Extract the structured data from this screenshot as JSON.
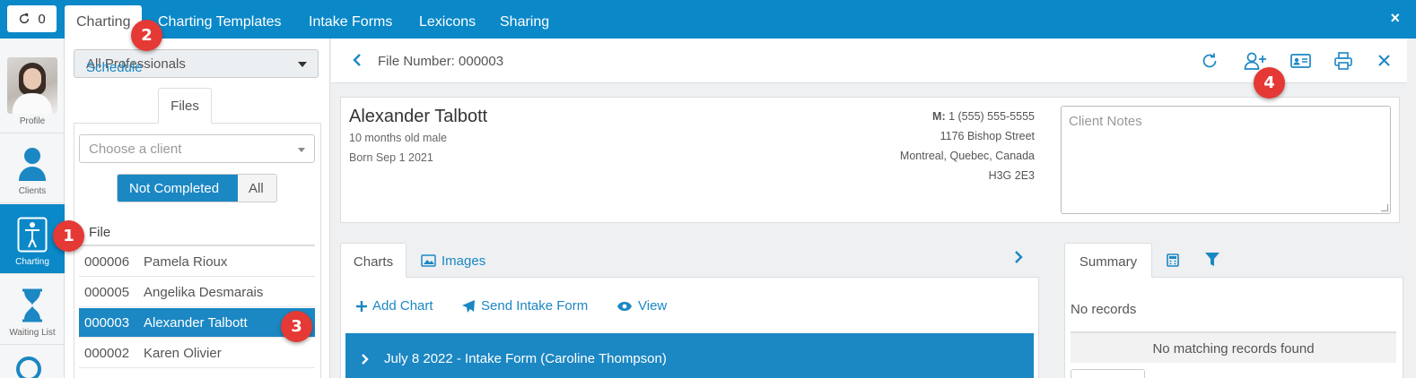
{
  "topbar": {
    "refresh_count": "0",
    "tabs": [
      "Charting",
      "Charting Templates",
      "Intake Forms",
      "Lexicons",
      "Sharing"
    ],
    "close": "×"
  },
  "leftnav": {
    "items": [
      "Profile",
      "Clients",
      "Charting",
      "Waiting List"
    ]
  },
  "files_panel": {
    "professional_select": "All Professionals",
    "tabs": [
      "Schedule",
      "Files"
    ],
    "client_placeholder": "Choose a client",
    "filter": {
      "on": "Not Completed",
      "off": "All"
    },
    "column_header": "File",
    "rows": [
      {
        "num": "000006",
        "name": "Pamela Rioux"
      },
      {
        "num": "000005",
        "name": "Angelika Desmarais"
      },
      {
        "num": "000003",
        "name": "Alexander Talbott"
      },
      {
        "num": "000002",
        "name": "Karen Olivier"
      }
    ]
  },
  "file_bar": {
    "title": "File Number: 000003"
  },
  "client": {
    "name": "Alexander Talbott",
    "age_sex": "10 months old male",
    "born": "Born Sep 1 2021",
    "phone_label": "M:",
    "phone": "1 (555) 555-5555",
    "street": "1176 Bishop Street",
    "city": "Montreal, Quebec, Canada",
    "postal": "H3G 2E3",
    "notes_placeholder": "Client Notes"
  },
  "charts": {
    "tabs": [
      "Charts",
      "Images"
    ],
    "actions": [
      "Add Chart",
      "Send Intake Form",
      "View"
    ],
    "entry": "July 8 2022 - Intake Form (Caroline Thompson)"
  },
  "summary": {
    "tab": "Summary",
    "no_records": "No records",
    "no_match": "No matching records found"
  },
  "badges": [
    "1",
    "2",
    "3",
    "4"
  ],
  "colors": {
    "primary": "#0a88c8",
    "link": "#1b87c3",
    "badge": "#e53935"
  }
}
